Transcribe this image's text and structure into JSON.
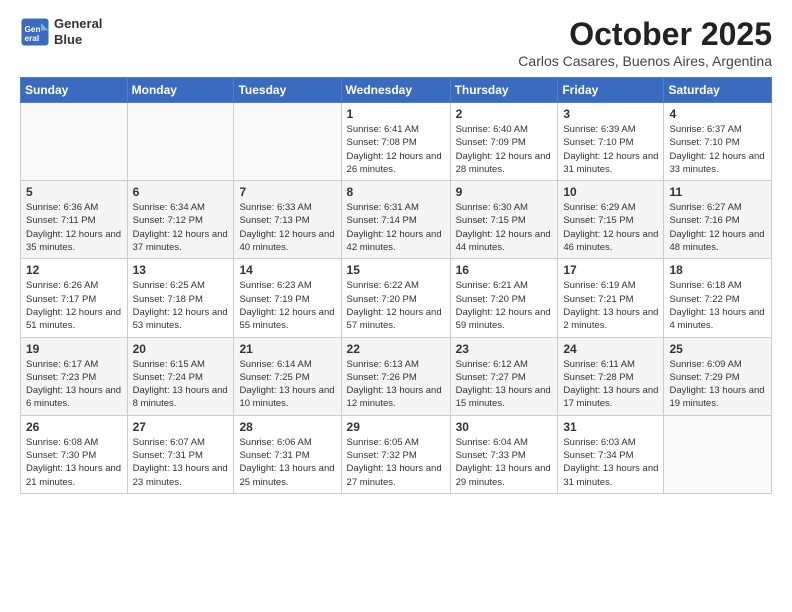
{
  "header": {
    "logo_line1": "General",
    "logo_line2": "Blue",
    "month": "October 2025",
    "location": "Carlos Casares, Buenos Aires, Argentina"
  },
  "days_of_week": [
    "Sunday",
    "Monday",
    "Tuesday",
    "Wednesday",
    "Thursday",
    "Friday",
    "Saturday"
  ],
  "weeks": [
    [
      {
        "day": "",
        "info": ""
      },
      {
        "day": "",
        "info": ""
      },
      {
        "day": "",
        "info": ""
      },
      {
        "day": "1",
        "info": "Sunrise: 6:41 AM\nSunset: 7:08 PM\nDaylight: 12 hours\nand 26 minutes."
      },
      {
        "day": "2",
        "info": "Sunrise: 6:40 AM\nSunset: 7:09 PM\nDaylight: 12 hours\nand 28 minutes."
      },
      {
        "day": "3",
        "info": "Sunrise: 6:39 AM\nSunset: 7:10 PM\nDaylight: 12 hours\nand 31 minutes."
      },
      {
        "day": "4",
        "info": "Sunrise: 6:37 AM\nSunset: 7:10 PM\nDaylight: 12 hours\nand 33 minutes."
      }
    ],
    [
      {
        "day": "5",
        "info": "Sunrise: 6:36 AM\nSunset: 7:11 PM\nDaylight: 12 hours\nand 35 minutes."
      },
      {
        "day": "6",
        "info": "Sunrise: 6:34 AM\nSunset: 7:12 PM\nDaylight: 12 hours\nand 37 minutes."
      },
      {
        "day": "7",
        "info": "Sunrise: 6:33 AM\nSunset: 7:13 PM\nDaylight: 12 hours\nand 40 minutes."
      },
      {
        "day": "8",
        "info": "Sunrise: 6:31 AM\nSunset: 7:14 PM\nDaylight: 12 hours\nand 42 minutes."
      },
      {
        "day": "9",
        "info": "Sunrise: 6:30 AM\nSunset: 7:15 PM\nDaylight: 12 hours\nand 44 minutes."
      },
      {
        "day": "10",
        "info": "Sunrise: 6:29 AM\nSunset: 7:15 PM\nDaylight: 12 hours\nand 46 minutes."
      },
      {
        "day": "11",
        "info": "Sunrise: 6:27 AM\nSunset: 7:16 PM\nDaylight: 12 hours\nand 48 minutes."
      }
    ],
    [
      {
        "day": "12",
        "info": "Sunrise: 6:26 AM\nSunset: 7:17 PM\nDaylight: 12 hours\nand 51 minutes."
      },
      {
        "day": "13",
        "info": "Sunrise: 6:25 AM\nSunset: 7:18 PM\nDaylight: 12 hours\nand 53 minutes."
      },
      {
        "day": "14",
        "info": "Sunrise: 6:23 AM\nSunset: 7:19 PM\nDaylight: 12 hours\nand 55 minutes."
      },
      {
        "day": "15",
        "info": "Sunrise: 6:22 AM\nSunset: 7:20 PM\nDaylight: 12 hours\nand 57 minutes."
      },
      {
        "day": "16",
        "info": "Sunrise: 6:21 AM\nSunset: 7:20 PM\nDaylight: 12 hours\nand 59 minutes."
      },
      {
        "day": "17",
        "info": "Sunrise: 6:19 AM\nSunset: 7:21 PM\nDaylight: 13 hours\nand 2 minutes."
      },
      {
        "day": "18",
        "info": "Sunrise: 6:18 AM\nSunset: 7:22 PM\nDaylight: 13 hours\nand 4 minutes."
      }
    ],
    [
      {
        "day": "19",
        "info": "Sunrise: 6:17 AM\nSunset: 7:23 PM\nDaylight: 13 hours\nand 6 minutes."
      },
      {
        "day": "20",
        "info": "Sunrise: 6:15 AM\nSunset: 7:24 PM\nDaylight: 13 hours\nand 8 minutes."
      },
      {
        "day": "21",
        "info": "Sunrise: 6:14 AM\nSunset: 7:25 PM\nDaylight: 13 hours\nand 10 minutes."
      },
      {
        "day": "22",
        "info": "Sunrise: 6:13 AM\nSunset: 7:26 PM\nDaylight: 13 hours\nand 12 minutes."
      },
      {
        "day": "23",
        "info": "Sunrise: 6:12 AM\nSunset: 7:27 PM\nDaylight: 13 hours\nand 15 minutes."
      },
      {
        "day": "24",
        "info": "Sunrise: 6:11 AM\nSunset: 7:28 PM\nDaylight: 13 hours\nand 17 minutes."
      },
      {
        "day": "25",
        "info": "Sunrise: 6:09 AM\nSunset: 7:29 PM\nDaylight: 13 hours\nand 19 minutes."
      }
    ],
    [
      {
        "day": "26",
        "info": "Sunrise: 6:08 AM\nSunset: 7:30 PM\nDaylight: 13 hours\nand 21 minutes."
      },
      {
        "day": "27",
        "info": "Sunrise: 6:07 AM\nSunset: 7:31 PM\nDaylight: 13 hours\nand 23 minutes."
      },
      {
        "day": "28",
        "info": "Sunrise: 6:06 AM\nSunset: 7:31 PM\nDaylight: 13 hours\nand 25 minutes."
      },
      {
        "day": "29",
        "info": "Sunrise: 6:05 AM\nSunset: 7:32 PM\nDaylight: 13 hours\nand 27 minutes."
      },
      {
        "day": "30",
        "info": "Sunrise: 6:04 AM\nSunset: 7:33 PM\nDaylight: 13 hours\nand 29 minutes."
      },
      {
        "day": "31",
        "info": "Sunrise: 6:03 AM\nSunset: 7:34 PM\nDaylight: 13 hours\nand 31 minutes."
      },
      {
        "day": "",
        "info": ""
      }
    ]
  ]
}
